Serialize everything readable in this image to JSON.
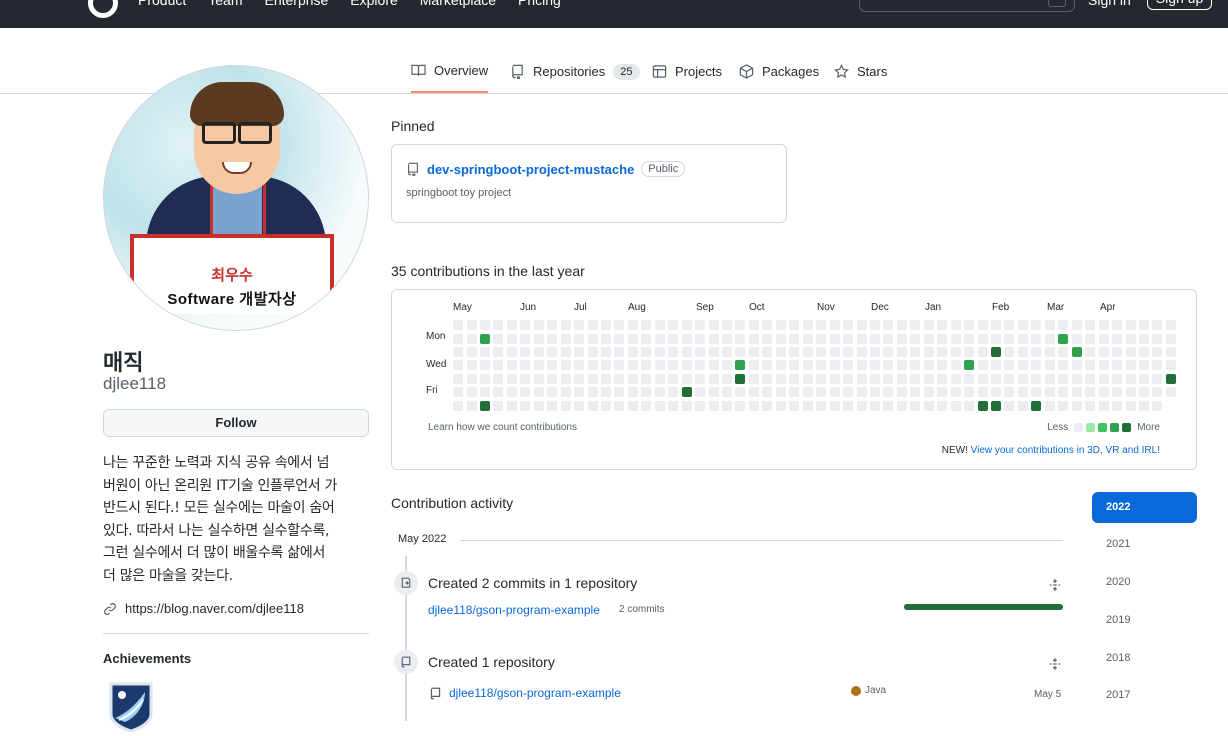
{
  "header": {
    "nav": [
      "Product",
      "Team",
      "Enterprise",
      "Explore",
      "Marketplace",
      "Pricing"
    ],
    "signin": "Sign in",
    "signup": "Sign up"
  },
  "tabs": [
    {
      "label": "Overview",
      "icon": "book-icon",
      "active": true
    },
    {
      "label": "Repositories",
      "icon": "repo-icon",
      "count": "25"
    },
    {
      "label": "Projects",
      "icon": "table-icon"
    },
    {
      "label": "Packages",
      "icon": "package-icon"
    },
    {
      "label": "Stars",
      "icon": "star-icon"
    }
  ],
  "profile": {
    "avatar_sign_name": "최우수",
    "avatar_sign_role": "Software 개발자상",
    "fullname": "매직",
    "username": "djlee118",
    "follow_label": "Follow",
    "bio_lines": [
      "나는 꾸준한 노력과 지식 공유 속에서 넘",
      "버원이 아닌 온리원 IT기술 인플루언서 가",
      "반드시 된다.! 모든 실수에는 마술이 숨어",
      "있다. 따라서 나는 실수하면 실수할수록,",
      "그런 실수에서 더 많이 배울수록 삶에서",
      "더 많은 마술을 갖는다."
    ],
    "blog": "https://blog.naver.com/djlee118",
    "achievements_title": "Achievements"
  },
  "pinned": {
    "title": "Pinned",
    "repo": "dev-springboot-project-mustache",
    "visibility": "Public",
    "description": "springboot toy project"
  },
  "contributions": {
    "title": "35 contributions in the last year",
    "months": [
      "May",
      "Jun",
      "Jul",
      "Aug",
      "Sep",
      "Oct",
      "Nov",
      "Dec",
      "Jan",
      "Feb",
      "Mar",
      "Apr"
    ],
    "day_labels": [
      "Mon",
      "Wed",
      "Fri"
    ],
    "learn": "Learn how we count contributions",
    "less": "Less",
    "more": "More",
    "new_prefix": "NEW!",
    "new_link": "View your contributions in 3D, VR and IRL!",
    "colors": [
      "#ebedf0",
      "#9be9a8",
      "#40c463",
      "#30a14e",
      "#216e39"
    ],
    "active_cells": [
      {
        "week": 2,
        "day": 1,
        "level": 3
      },
      {
        "week": 2,
        "day": 6,
        "level": 4
      },
      {
        "week": 17,
        "day": 5,
        "level": 4
      },
      {
        "week": 21,
        "day": 3,
        "level": 3
      },
      {
        "week": 21,
        "day": 4,
        "level": 4
      },
      {
        "week": 38,
        "day": 3,
        "level": 3
      },
      {
        "week": 39,
        "day": 6,
        "level": 4
      },
      {
        "week": 40,
        "day": 2,
        "level": 4
      },
      {
        "week": 40,
        "day": 6,
        "level": 4
      },
      {
        "week": 43,
        "day": 6,
        "level": 4
      },
      {
        "week": 45,
        "day": 1,
        "level": 3
      },
      {
        "week": 46,
        "day": 2,
        "level": 3
      },
      {
        "week": 53,
        "day": 4,
        "level": 4
      }
    ]
  },
  "activity": {
    "title": "Contribution activity",
    "month": "May 2022",
    "items": [
      {
        "heading": "Created 2 commits in 1 repository",
        "repo": "djlee118/gson-program-example",
        "detail": "2 commits"
      },
      {
        "heading": "Created 1 repository",
        "repo": "djlee118/gson-program-example",
        "language": "Java",
        "language_color": "#b07219",
        "date": "May 5"
      }
    ],
    "bar_fraction": 1.0
  },
  "years": [
    "2022",
    "2021",
    "2020",
    "2019",
    "2018",
    "2017"
  ],
  "active_year": "2022"
}
